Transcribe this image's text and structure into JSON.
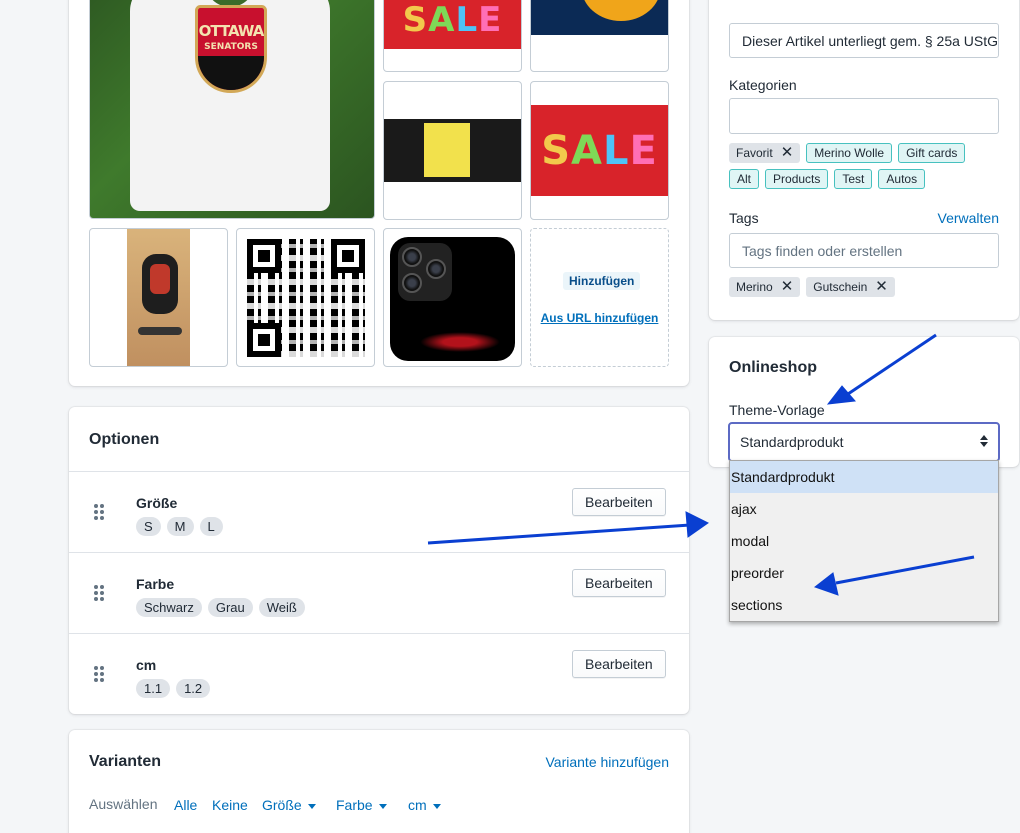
{
  "media": {
    "shirt_line1": "OTTAWA",
    "shirt_line2": "SENATORS",
    "sale_text": [
      "S",
      "A",
      "L",
      "E"
    ],
    "add_label": "Hinzufügen",
    "url_label": "Aus URL hinzufügen"
  },
  "options": {
    "title": "Optionen",
    "edit_label": "Bearbeiten",
    "items": [
      {
        "name": "Größe",
        "values": [
          "S",
          "M",
          "L"
        ]
      },
      {
        "name": "Farbe",
        "values": [
          "Schwarz",
          "Grau",
          "Weiß"
        ]
      },
      {
        "name": "cm",
        "values": [
          "1.1",
          "1.2"
        ]
      }
    ]
  },
  "variants": {
    "title": "Varianten",
    "add_link": "Variante hinzufügen",
    "select_label": "Auswählen",
    "filters": [
      "Alle",
      "Keine",
      "Größe",
      "Farbe",
      "cm"
    ]
  },
  "organization": {
    "tax_note_value": "Dieser Artikel unterliegt gem. § 25a UStG",
    "categories_label": "Kategorien",
    "categories_value": "",
    "suggested_tags": [
      {
        "label": "Favorit",
        "removable": true
      },
      {
        "label": "Merino Wolle",
        "removable": false
      },
      {
        "label": "Gift cards",
        "removable": false
      },
      {
        "label": "Alt",
        "removable": false
      },
      {
        "label": "Products",
        "removable": false
      },
      {
        "label": "Test",
        "removable": false
      },
      {
        "label": "Autos",
        "removable": false
      }
    ],
    "tags_label": "Tags",
    "tags_manage": "Verwalten",
    "tags_placeholder": "Tags finden oder erstellen",
    "tags": [
      "Merino",
      "Gutschein"
    ]
  },
  "online_store": {
    "title": "Onlineshop",
    "template_label": "Theme-Vorlage",
    "selected": "Standardprodukt",
    "options": [
      "Standardprodukt",
      "ajax",
      "modal",
      "preorder",
      "sections"
    ]
  },
  "colors": {
    "accent": "#5c6ac4",
    "link": "#006fbb",
    "annotation_arrow": "#0a3fd1"
  }
}
